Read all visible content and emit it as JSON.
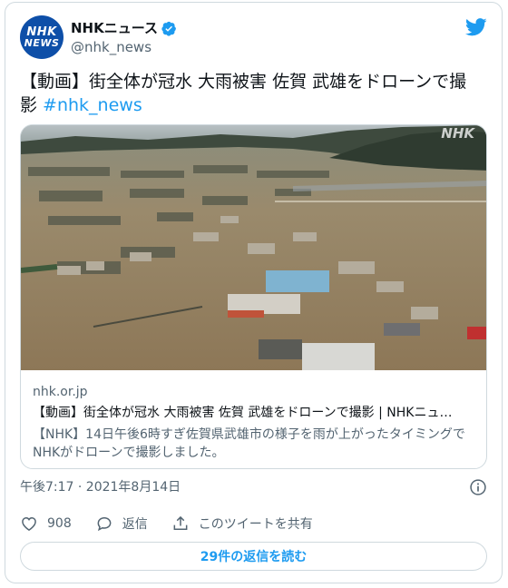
{
  "author": {
    "display_name": "NHKニュース",
    "handle": "@nhk_news",
    "avatar": {
      "line1": "NHK",
      "line2": "NEWS"
    },
    "verified_icon": "verified-badge-icon"
  },
  "brand_color": "#1d9bf0",
  "tweet": {
    "text": "【動画】街全体が冠水 大雨被害 佐賀 武雄をドローンで撮影 ",
    "hashtag": "#nhk_news"
  },
  "link_card": {
    "domain": "nhk.or.jp",
    "title": "【動画】街全体が冠水 大雨被害 佐賀 武雄をドローンで撮影 | NHKニュ…",
    "description": "【NHK】14日午後6時すぎ佐賀県武雄市の様子を雨が上がったタイミングでNHKがドローンで撮影しました。",
    "image_watermark": "NHK"
  },
  "timestamp": "午後7:17 · 2021年8月14日",
  "actions": {
    "like_count": "908",
    "reply_label": "返信",
    "share_label": "このツイートを共有"
  },
  "read_replies_label": "29件の返信を読む"
}
